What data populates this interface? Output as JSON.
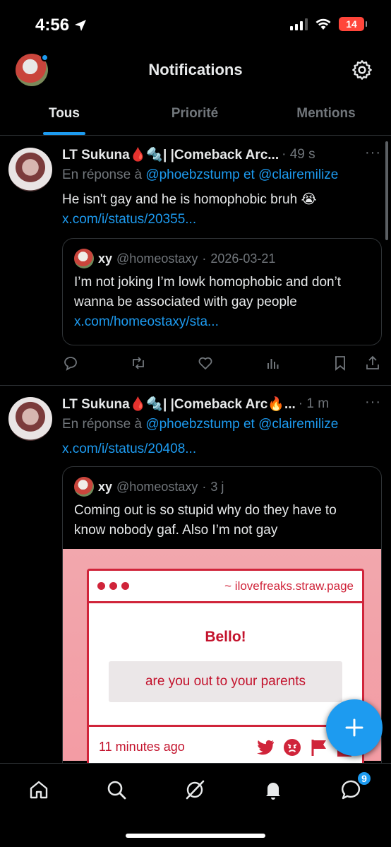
{
  "status_bar": {
    "time": "4:56",
    "battery": "14"
  },
  "header": {
    "title": "Notifications"
  },
  "tabs": [
    {
      "label": "Tous",
      "active": true
    },
    {
      "label": "Priorité",
      "active": false
    },
    {
      "label": "Mentions",
      "active": false
    }
  ],
  "posts": [
    {
      "author": "LT Sukuna🩸🔩| |Comeback Arc...",
      "time": "49 s",
      "reply_prefix": "En réponse à",
      "reply_to_1": "@phoebzstump",
      "reply_joiner": "et",
      "reply_to_2": "@clairemilize",
      "text": "He isn't gay and he is homophobic bruh 😭",
      "link": "x.com/i/status/20355...",
      "quote": {
        "name": "xy",
        "handle": "@homeostaxy",
        "time": "2026-03-21",
        "text": "I’m not joking I’m lowk homophobic and don’t wanna be associated with gay people",
        "link": "x.com/homeostaxy/sta..."
      }
    },
    {
      "author": "LT Sukuna🩸🔩| |Comeback Arc🔥...",
      "time": "1 m",
      "reply_prefix": "En réponse à",
      "reply_to_1": "@phoebzstump",
      "reply_joiner": "et",
      "reply_to_2": "@clairemilize",
      "link": "x.com/i/status/20408...",
      "quote": {
        "name": "xy",
        "handle": "@homeostaxy",
        "time": "3 j",
        "text": "Coming out is so stupid why do they have to know nobody gaf. Also I’m not gay",
        "image": {
          "url": "~ ilovefreaks.straw.page",
          "title": "Bello!",
          "question": "are you out to your parents",
          "footer_time": "11 minutes ago"
        }
      }
    }
  ],
  "bottom_nav": {
    "messages_badge": "9"
  },
  "colors": {
    "accent": "#1d9bf0",
    "background": "#000000",
    "muted": "#71767b",
    "card_red": "#d0243a"
  },
  "icons": [
    "location-arrow-icon",
    "gear-icon",
    "reply-icon",
    "repost-icon",
    "like-icon",
    "views-icon",
    "bookmark-icon",
    "share-icon",
    "compose-icon",
    "home-icon",
    "search-icon",
    "grok-icon",
    "bell-icon",
    "messages-icon"
  ]
}
